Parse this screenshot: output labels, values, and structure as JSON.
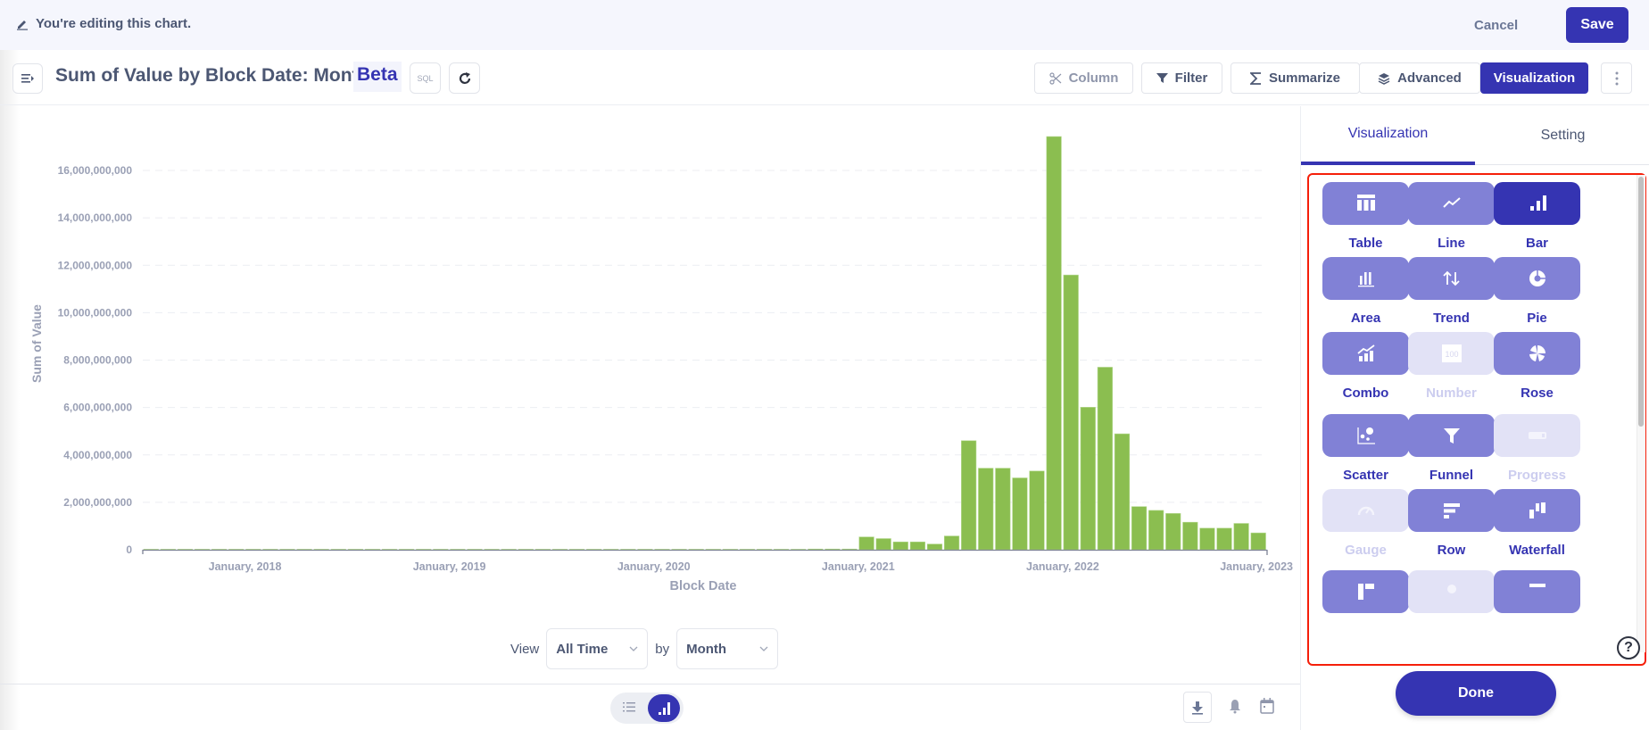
{
  "edit_bar": {
    "message": "You're editing this chart.",
    "cancel_label": "Cancel",
    "save_label": "Save"
  },
  "header": {
    "title": "Sum of Value by Block Date: Month",
    "badge": "Beta",
    "sql_label": "SQL",
    "buttons": {
      "column": "Column",
      "filter": "Filter",
      "summarize": "Summarize",
      "advanced": "Advanced",
      "visualization": "Visualization"
    }
  },
  "controls": {
    "view_label": "View",
    "view_value": "All Time",
    "by_label": "by",
    "by_value": "Month"
  },
  "right_panel": {
    "tabs": [
      {
        "label": "Visualization",
        "active": true
      },
      {
        "label": "Setting",
        "active": false
      }
    ],
    "viz_types": [
      {
        "label": "Table",
        "icon": "table-icon",
        "state": "enabled"
      },
      {
        "label": "Line",
        "icon": "line-chart-icon",
        "state": "enabled"
      },
      {
        "label": "Bar",
        "icon": "bar-chart-icon",
        "state": "selected"
      },
      {
        "label": "Area",
        "icon": "area-chart-icon",
        "state": "enabled"
      },
      {
        "label": "Trend",
        "icon": "trend-icon",
        "state": "enabled"
      },
      {
        "label": "Pie",
        "icon": "pie-chart-icon",
        "state": "enabled"
      },
      {
        "label": "Combo",
        "icon": "combo-chart-icon",
        "state": "enabled"
      },
      {
        "label": "Number",
        "icon": "number-icon",
        "state": "disabled"
      },
      {
        "label": "Rose",
        "icon": "rose-chart-icon",
        "state": "enabled"
      },
      {
        "label": "Scatter",
        "icon": "scatter-icon",
        "state": "enabled"
      },
      {
        "label": "Funnel",
        "icon": "funnel-icon",
        "state": "enabled"
      },
      {
        "label": "Progress",
        "icon": "progress-icon",
        "state": "disabled"
      },
      {
        "label": "Gauge",
        "icon": "gauge-icon",
        "state": "disabled"
      },
      {
        "label": "Row",
        "icon": "row-chart-icon",
        "state": "enabled"
      },
      {
        "label": "Waterfall",
        "icon": "waterfall-icon",
        "state": "enabled"
      },
      {
        "label": "",
        "icon": "pivot-icon",
        "state": "enabled"
      },
      {
        "label": "",
        "icon": "map-icon",
        "state": "disabled"
      },
      {
        "label": "",
        "icon": "detail-icon",
        "state": "enabled"
      }
    ],
    "number_glyph": "100",
    "help_label": "?",
    "done_label": "Done"
  },
  "colors": {
    "accent": "#3534b2",
    "viz_enabled": "#8181d6",
    "viz_disabled": "#e2e2f6",
    "bar": "#8bbe50",
    "highlight_border": "#f51f0a"
  },
  "chart_data": {
    "type": "bar",
    "title": "Sum of Value by Block Date: Month",
    "xlabel": "Block Date",
    "ylabel": "Sum of Value",
    "ylim": [
      0,
      17500000000
    ],
    "yticks": [
      0,
      2000000000,
      4000000000,
      6000000000,
      8000000000,
      10000000000,
      12000000000,
      14000000000,
      16000000000
    ],
    "ytick_labels": [
      "0",
      "2,000,000,000",
      "4,000,000,000",
      "6,000,000,000",
      "8,000,000,000",
      "10,000,000,000",
      "12,000,000,000",
      "14,000,000,000",
      "16,000,000,000"
    ],
    "xtick_labels": [
      "January, 2018",
      "January, 2019",
      "January, 2020",
      "January, 2021",
      "January, 2022",
      "January, 2023"
    ],
    "grid": true,
    "legend": "none",
    "x_start": "2017-07",
    "x_end": "2023-01",
    "categories": [
      "2017-07",
      "2017-08",
      "2017-09",
      "2017-10",
      "2017-11",
      "2017-12",
      "2018-01",
      "2018-02",
      "2018-03",
      "2018-04",
      "2018-05",
      "2018-06",
      "2018-07",
      "2018-08",
      "2018-09",
      "2018-10",
      "2018-11",
      "2018-12",
      "2019-01",
      "2019-02",
      "2019-03",
      "2019-04",
      "2019-05",
      "2019-06",
      "2019-07",
      "2019-08",
      "2019-09",
      "2019-10",
      "2019-11",
      "2019-12",
      "2020-01",
      "2020-02",
      "2020-03",
      "2020-04",
      "2020-05",
      "2020-06",
      "2020-07",
      "2020-08",
      "2020-09",
      "2020-10",
      "2020-11",
      "2020-12",
      "2021-01",
      "2021-02",
      "2021-03",
      "2021-04",
      "2021-05",
      "2021-06",
      "2021-07",
      "2021-08",
      "2021-09",
      "2021-10",
      "2021-11",
      "2021-12",
      "2022-01",
      "2022-02",
      "2022-03",
      "2022-04",
      "2022-05",
      "2022-06",
      "2022-07",
      "2022-08",
      "2022-09",
      "2022-10",
      "2022-11",
      "2022-12"
    ],
    "values": [
      20000000,
      20000000,
      20000000,
      20000000,
      20000000,
      20000000,
      20000000,
      20000000,
      20000000,
      20000000,
      20000000,
      20000000,
      20000000,
      20000000,
      20000000,
      20000000,
      20000000,
      20000000,
      20000000,
      20000000,
      20000000,
      20000000,
      20000000,
      20000000,
      20000000,
      20000000,
      20000000,
      20000000,
      20000000,
      20000000,
      20000000,
      20000000,
      20000000,
      20000000,
      20000000,
      20000000,
      20000000,
      20000000,
      20000000,
      30000000,
      30000000,
      30000000,
      540000000,
      470000000,
      330000000,
      330000000,
      240000000,
      580000000,
      4600000000,
      3440000000,
      3440000000,
      3030000000,
      3320000000,
      17430000000,
      11590000000,
      6010000000,
      7700000000,
      4890000000,
      1820000000,
      1660000000,
      1530000000,
      1160000000,
      910000000,
      910000000,
      1110000000,
      710000000
    ]
  }
}
